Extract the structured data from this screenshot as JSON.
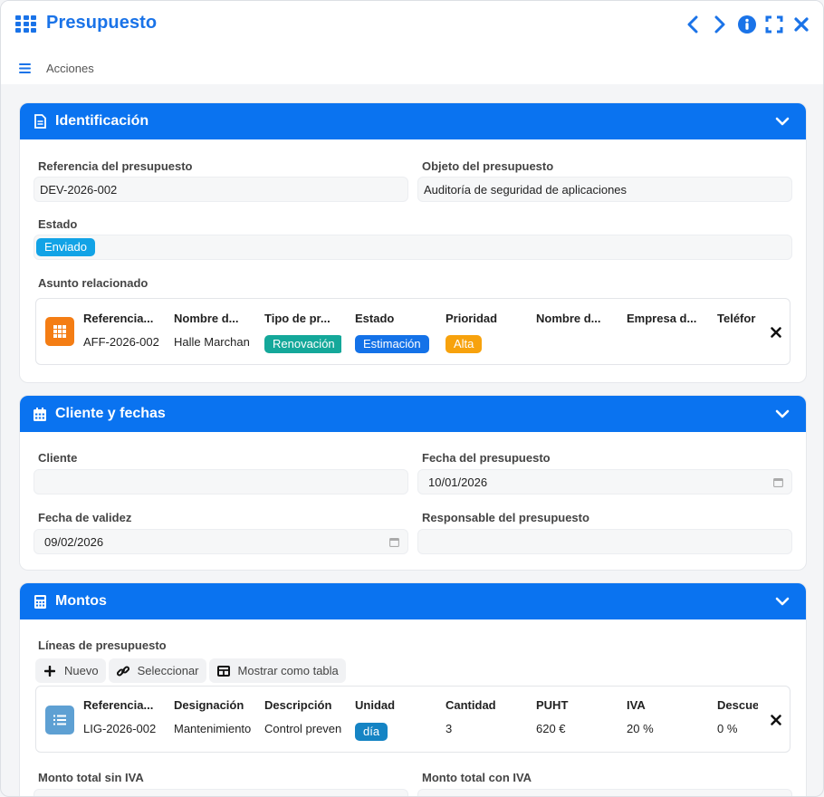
{
  "window": {
    "title": "Presupuesto"
  },
  "menu": {
    "label": "Acciones"
  },
  "sections": {
    "identificacion": {
      "title": "Identificación",
      "referencia_label": "Referencia del presupuesto",
      "referencia_value": "DEV-2026-002",
      "objeto_label": "Objeto del presupuesto",
      "objeto_value": "Auditoría de seguridad de aplicaciones",
      "estado_label": "Estado",
      "estado_value": "Enviado",
      "asunto_label": "Asunto relacionado",
      "asunto": {
        "headers": [
          "Referencia...",
          "Nombre d...",
          "Tipo de pr...",
          "Estado",
          "Prioridad",
          "Nombre d...",
          "Empresa d...",
          "Teléfor"
        ],
        "reference": "AFF-2026-002",
        "name": "Halle Marchan",
        "tipo": "Renovación",
        "estado": "Estimación",
        "prioridad": "Alta"
      }
    },
    "cliente": {
      "title": "Cliente y fechas",
      "cliente_label": "Cliente",
      "cliente_value": "",
      "fecha_label": "Fecha del presupuesto",
      "fecha_value": "10/01/2026",
      "validez_label": "Fecha de validez",
      "validez_value": "09/02/2026",
      "responsable_label": "Responsable del presupuesto",
      "responsable_value": ""
    },
    "montos": {
      "title": "Montos",
      "lineas_label": "Líneas de presupuesto",
      "buttons": {
        "nuevo": "Nuevo",
        "seleccionar": "Seleccionar",
        "tabla": "Mostrar como tabla"
      },
      "linea": {
        "headers": [
          "Referencia...",
          "Designación",
          "Descripción",
          "Unidad",
          "Cantidad",
          "PUHT",
          "IVA",
          "Descue"
        ],
        "reference": "LIG-2026-002",
        "designacion": "Mantenimiento",
        "descripcion": "Control preventivo",
        "unidad": "día",
        "cantidad": "3",
        "puht": "620 €",
        "iva": "20 %",
        "descuento": "0 %"
      },
      "total_sin_label": "Monto total sin IVA",
      "total_con_label": "Monto total con IVA"
    }
  },
  "colors": {
    "primary": "#0a73f0",
    "badge_enviado": "#12a3e6",
    "badge_renovacion": "#14a89a",
    "badge_estimacion": "#1472e8",
    "badge_alta": "#f7a20d",
    "badge_dia": "#1584c4",
    "asunto_icon": "#f47d14",
    "linea_icon": "#5ea0d3"
  }
}
